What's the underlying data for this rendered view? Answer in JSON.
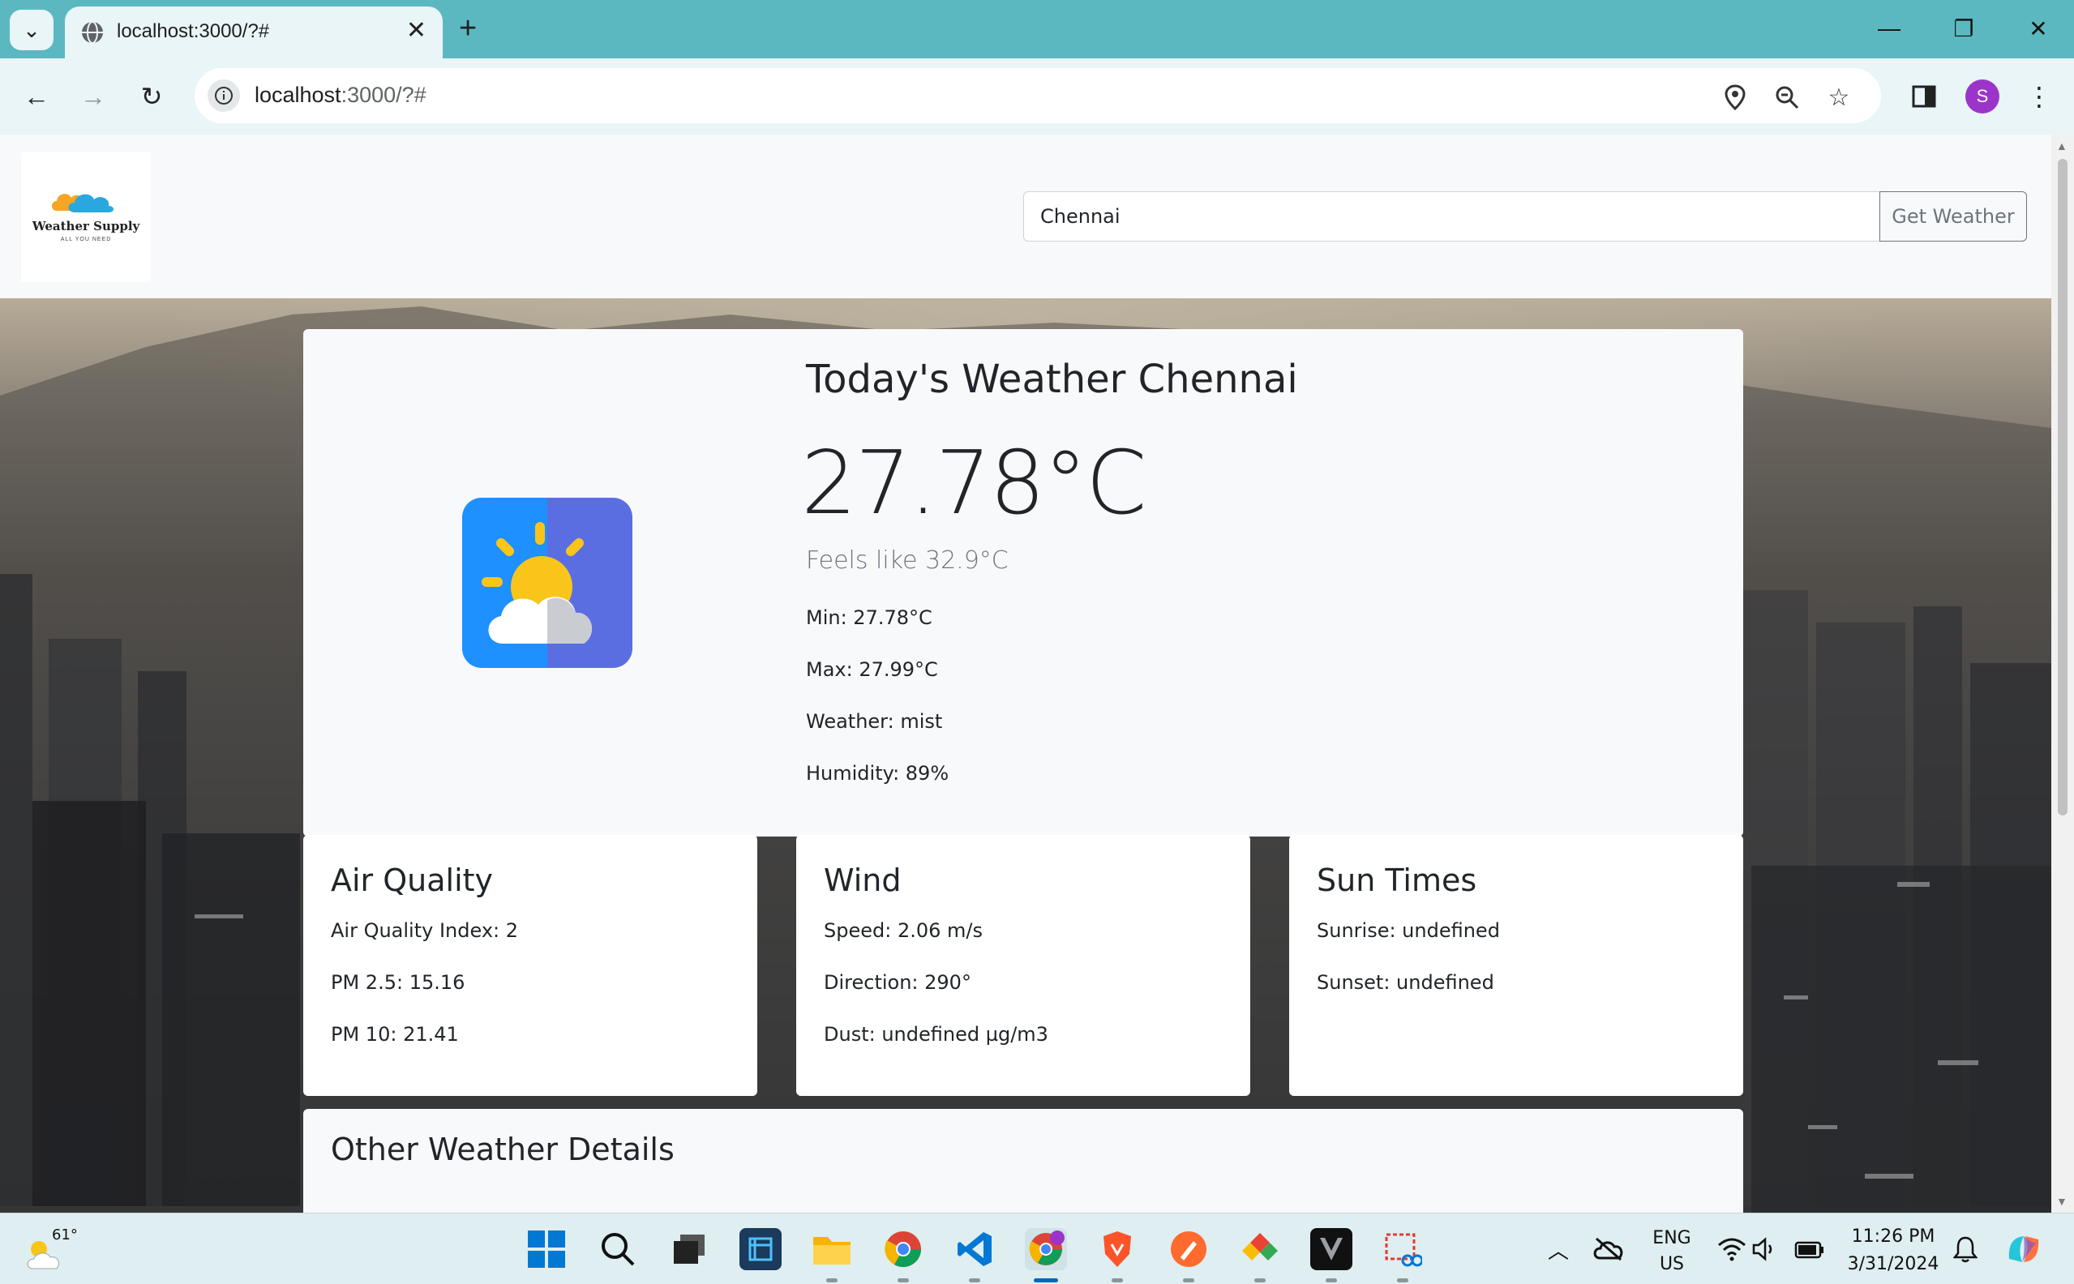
{
  "browser": {
    "tab_title": "localhost:3000/?#",
    "url_host": "localhost",
    "url_path": ":3000/?#",
    "profile_initial": "S"
  },
  "header": {
    "logo_name": "Weather Supply",
    "logo_tagline": "ALL YOU NEED",
    "search_value": "Chennai",
    "search_button": "Get Weather"
  },
  "today": {
    "title": "Today's Weather Chennai",
    "temperature": "27.78°C",
    "feels_like": "Feels like 32.9°C",
    "min": "Min: 27.78°C",
    "max": "Max: 27.99°C",
    "weather": "Weather: mist",
    "humidity": "Humidity: 89%"
  },
  "air_quality": {
    "title": "Air Quality",
    "index": "Air Quality Index: 2",
    "pm25": "PM 2.5: 15.16",
    "pm10": "PM 10: 21.41"
  },
  "wind": {
    "title": "Wind",
    "speed": "Speed: 2.06 m/s",
    "direction": "Direction: 290°",
    "dust": "Dust: undefined µg/m3"
  },
  "sun_times": {
    "title": "Sun Times",
    "sunrise": "Sunrise: undefined",
    "sunset": "Sunset: undefined"
  },
  "other": {
    "title": "Other Weather Details"
  },
  "taskbar": {
    "weather_temp": "61°",
    "lang_line1": "ENG",
    "lang_line2": "US",
    "time": "11:26 PM",
    "date": "3/31/2024"
  },
  "colors": {
    "chrome_tab_bar": "#5cb8c0",
    "chrome_toolbar": "#e9f5f6",
    "card_bg": "#f8f9fa",
    "text": "#212529",
    "muted": "#6c757d",
    "icon_blue": "#1e90ff",
    "icon_purple": "#5b6ee1",
    "sun_yellow": "#f9c51b"
  }
}
